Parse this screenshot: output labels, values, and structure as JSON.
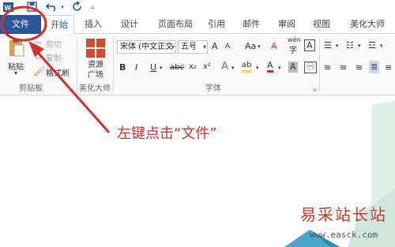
{
  "quick_access": {
    "word_icon": "word-logo",
    "save_icon": "save-icon",
    "undo_icon": "undo-icon",
    "redo_icon": "redo-icon",
    "customize_icon": "customize-icon"
  },
  "tabs": [
    {
      "label": "文件"
    },
    {
      "label": "开始"
    },
    {
      "label": "插入"
    },
    {
      "label": "设计"
    },
    {
      "label": "页面布局"
    },
    {
      "label": "引用"
    },
    {
      "label": "邮件"
    },
    {
      "label": "审阅"
    },
    {
      "label": "视图"
    },
    {
      "label": "美化大师"
    }
  ],
  "clipboard": {
    "paste": "粘贴",
    "cut": "剪切",
    "copy": "复制",
    "format_painter": "格式刷",
    "group_label": "剪贴板"
  },
  "beautify": {
    "button": "资源广场",
    "group_label": "美化大师"
  },
  "font": {
    "font_name": "宋体 (中文正文",
    "font_size": "五号",
    "wen": "wén",
    "group_label": "字体",
    "bold": "B",
    "italic": "I",
    "underline": "U",
    "strike": "abc",
    "subscript": "x₂",
    "superscript": "x²",
    "grow": "A",
    "shrink": "A",
    "case": "Aa",
    "font_color": "A",
    "highlight": "ab",
    "char_shading": "A",
    "char_border": "A",
    "phonetic": "字"
  },
  "annotation": "左键点击“文件”",
  "watermark": {
    "line1": "易采站长站",
    "line2": "www.easck.com"
  },
  "colors": {
    "file_tab": "#2b579a",
    "annotation": "#d2302a",
    "circle": "#d2302a",
    "doc_accent": "#dff0e8"
  }
}
